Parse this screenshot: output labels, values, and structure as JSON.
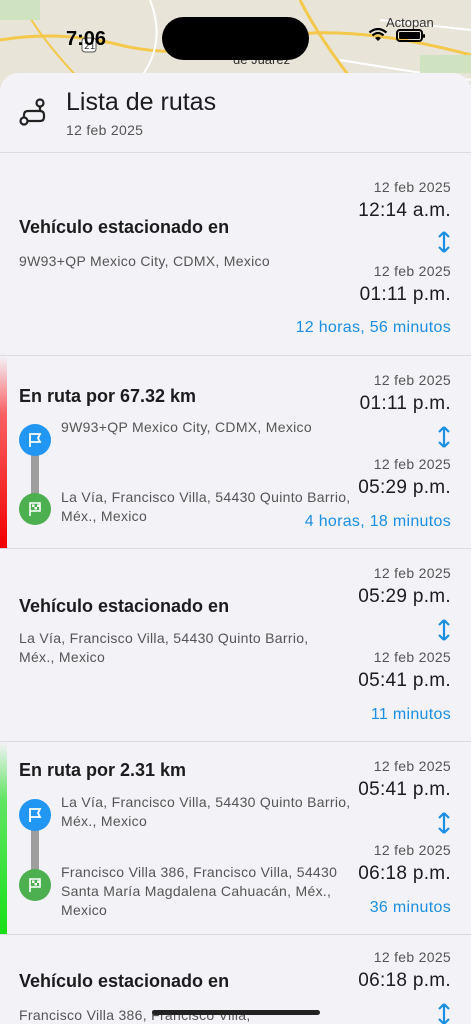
{
  "status_bar": {
    "time": "7:06"
  },
  "map": {
    "labels": [
      "Actopan",
      "de Juárez"
    ],
    "road_shield": "21"
  },
  "header": {
    "title": "Lista de rutas",
    "date": "12 feb 2025"
  },
  "items": [
    {
      "type": "parked",
      "title": "Vehículo estacionado en",
      "address": "9W93+QP Mexico City, CDMX, Mexico",
      "start_date": "12 feb 2025",
      "start_time": "12:14 a.m.",
      "end_date": "12 feb 2025",
      "end_time": "01:11 p.m.",
      "duration": "12 horas, 56 minutos"
    },
    {
      "type": "route",
      "title": "En ruta por 67.32 km",
      "from": "9W93+QP Mexico City, CDMX, Mexico",
      "to": "La Vía, Francisco Villa, 54430 Quinto Barrio, Méx., Mexico",
      "start_date": "12 feb 2025",
      "start_time": "01:11 p.m.",
      "end_date": "12 feb 2025",
      "end_time": "05:29 p.m.",
      "duration": "4 horas, 18 minutos",
      "accent": "#f20000"
    },
    {
      "type": "parked",
      "title": "Vehículo estacionado en",
      "address": "La Vía, Francisco Villa, 54430 Quinto Barrio, Méx., Mexico",
      "start_date": "12 feb 2025",
      "start_time": "05:29 p.m.",
      "end_date": "12 feb 2025",
      "end_time": "05:41 p.m.",
      "duration": "11 minutos"
    },
    {
      "type": "route",
      "title": "En ruta por 2.31 km",
      "from": "La Vía, Francisco Villa, 54430 Quinto Barrio, Méx., Mexico",
      "to": "Francisco Villa 386, Francisco Villa, 54430 Santa María Magdalena Cahuacán, Méx., Mexico",
      "start_date": "12 feb 2025",
      "start_time": "05:41 p.m.",
      "end_date": "12 feb 2025",
      "end_time": "06:18 p.m.",
      "duration": "36 minutos",
      "accent": "#18e018"
    },
    {
      "type": "parked",
      "title": "Vehículo estacionado en",
      "address": "Francisco Villa 386, Francisco Villa,",
      "start_date": "12 feb 2025",
      "start_time": "06:18 p.m."
    }
  ],
  "colors": {
    "accent_blue": "#1a8fe3",
    "start_pin": "#2196f3",
    "end_pin": "#4caf50"
  }
}
